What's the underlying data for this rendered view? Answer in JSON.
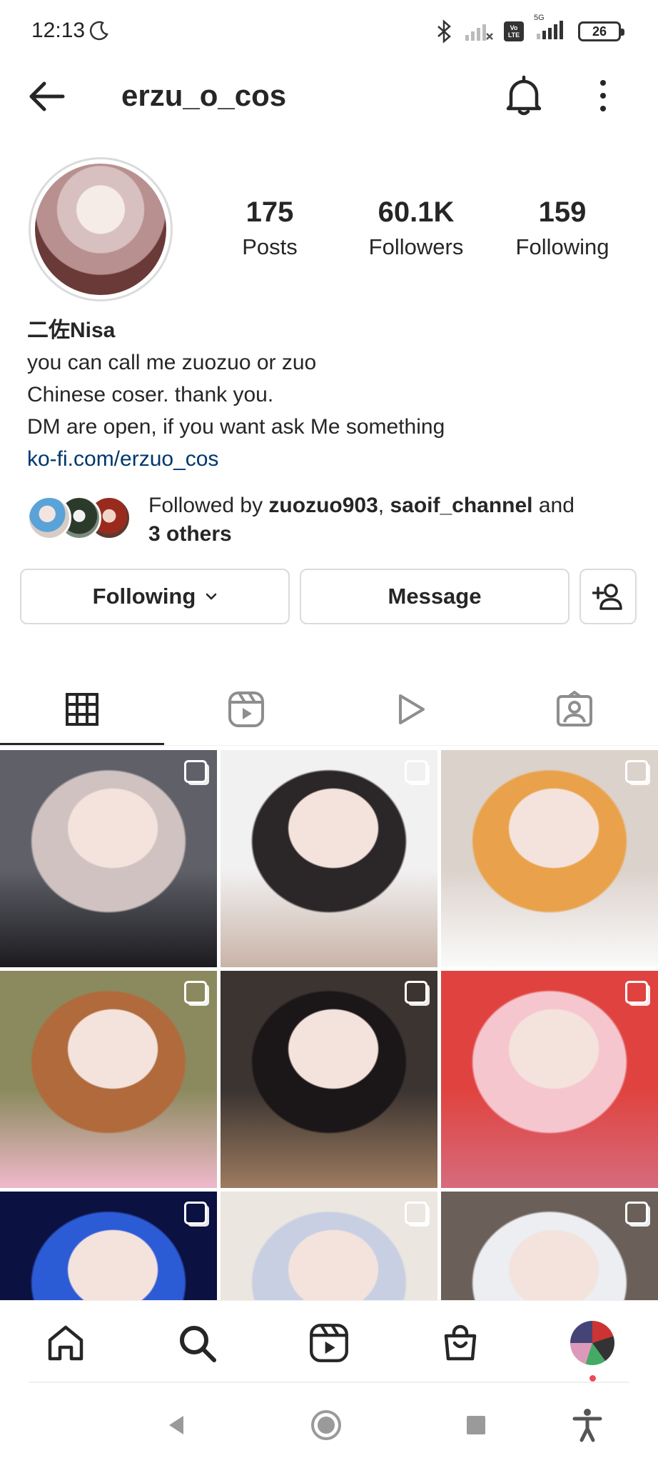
{
  "status_bar": {
    "time": "12:13",
    "battery": "26",
    "volte": "Vo LTE",
    "network": "5G"
  },
  "header": {
    "username": "erzu_o_cos"
  },
  "profile": {
    "stats": [
      {
        "value": "175",
        "label": "Posts"
      },
      {
        "value": "60.1K",
        "label": "Followers"
      },
      {
        "value": "159",
        "label": "Following"
      }
    ],
    "bio": {
      "name": "二佐Nisa",
      "lines": [
        "you can call me zuozuo or zuo",
        "Chinese coser. thank you.",
        "DM are open, if you want ask Me something"
      ],
      "link": "ko-fi.com/erzuo_cos"
    },
    "followed_by": {
      "prefix": "Followed by ",
      "user1": "zuozuo903",
      "sep": ", ",
      "user2": "saoif_channel",
      "and": " and",
      "others": "3 others"
    }
  },
  "actions": {
    "following_label": "Following",
    "message_label": "Message"
  },
  "tabs": [
    {
      "name": "grid",
      "icon": "grid-icon",
      "active": true
    },
    {
      "name": "reels",
      "icon": "reels-icon",
      "active": false
    },
    {
      "name": "videos",
      "icon": "play-icon",
      "active": false
    },
    {
      "name": "tagged",
      "icon": "tagged-icon",
      "active": false
    }
  ],
  "grid_posts": [
    {
      "colors": [
        "#5f6068",
        "#cfc2c0",
        "#1b1b1f"
      ]
    },
    {
      "colors": [
        "#f1f1f1",
        "#2b2628",
        "#c9b3a7"
      ]
    },
    {
      "colors": [
        "#dcd2cc",
        "#e9a24b",
        "#fafafa"
      ]
    },
    {
      "colors": [
        "#8b8a5e",
        "#b06a3c",
        "#f0b9cb"
      ]
    },
    {
      "colors": [
        "#3b3431",
        "#1b1718",
        "#9e7b5f"
      ]
    },
    {
      "colors": [
        "#e0433f",
        "#f6c6cf",
        "#d66b7d"
      ]
    },
    {
      "colors": [
        "#0b1140",
        "#2c5bd6",
        "#111111"
      ]
    },
    {
      "colors": [
        "#ebe6e0",
        "#c8cfe2",
        "#8c8f6a"
      ]
    },
    {
      "colors": [
        "#6a6059",
        "#eceef2",
        "#9ed7e8"
      ]
    }
  ],
  "bottom_nav": [
    "home-icon",
    "search-icon",
    "reels-icon",
    "shop-icon",
    "profile-avatar"
  ],
  "colors": {
    "text": "#262626",
    "link": "#00376b",
    "border": "#dbdbdb",
    "notification": "#ed4956"
  }
}
